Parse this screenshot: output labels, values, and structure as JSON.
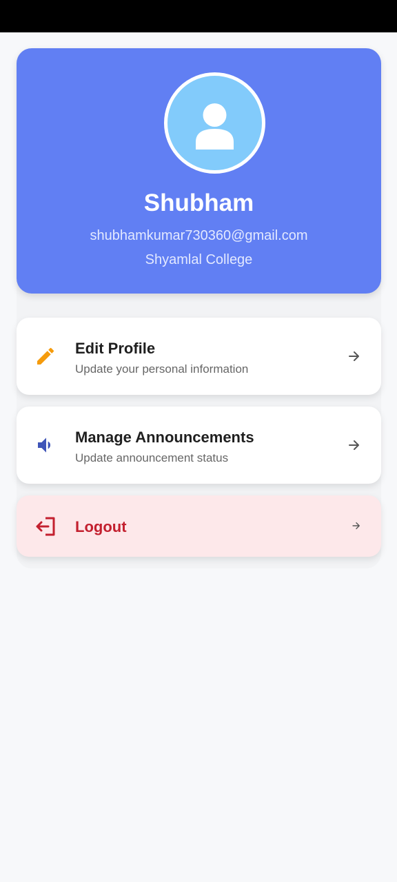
{
  "profile": {
    "name": "Shubham",
    "email": "shubhamkumar730360@gmail.com",
    "college": "Shyamlal College",
    "avatar_icon": "person-icon"
  },
  "menu": {
    "edit_profile": {
      "title": "Edit Profile",
      "subtitle": "Update your personal information",
      "icon": "pencil-icon",
      "icon_color": "#f59b0c"
    },
    "announcements": {
      "title": "Manage Announcements",
      "subtitle": "Update announcement status",
      "icon": "megaphone-icon",
      "icon_color": "#3f55b8"
    },
    "logout": {
      "title": "Logout",
      "icon": "logout-icon",
      "icon_color": "#c3202f"
    }
  },
  "colors": {
    "profile_card": "#617ff3",
    "avatar_bg": "#82cbfb",
    "logout_bg": "#fde8ea",
    "page_bg": "#f7f8fa"
  }
}
